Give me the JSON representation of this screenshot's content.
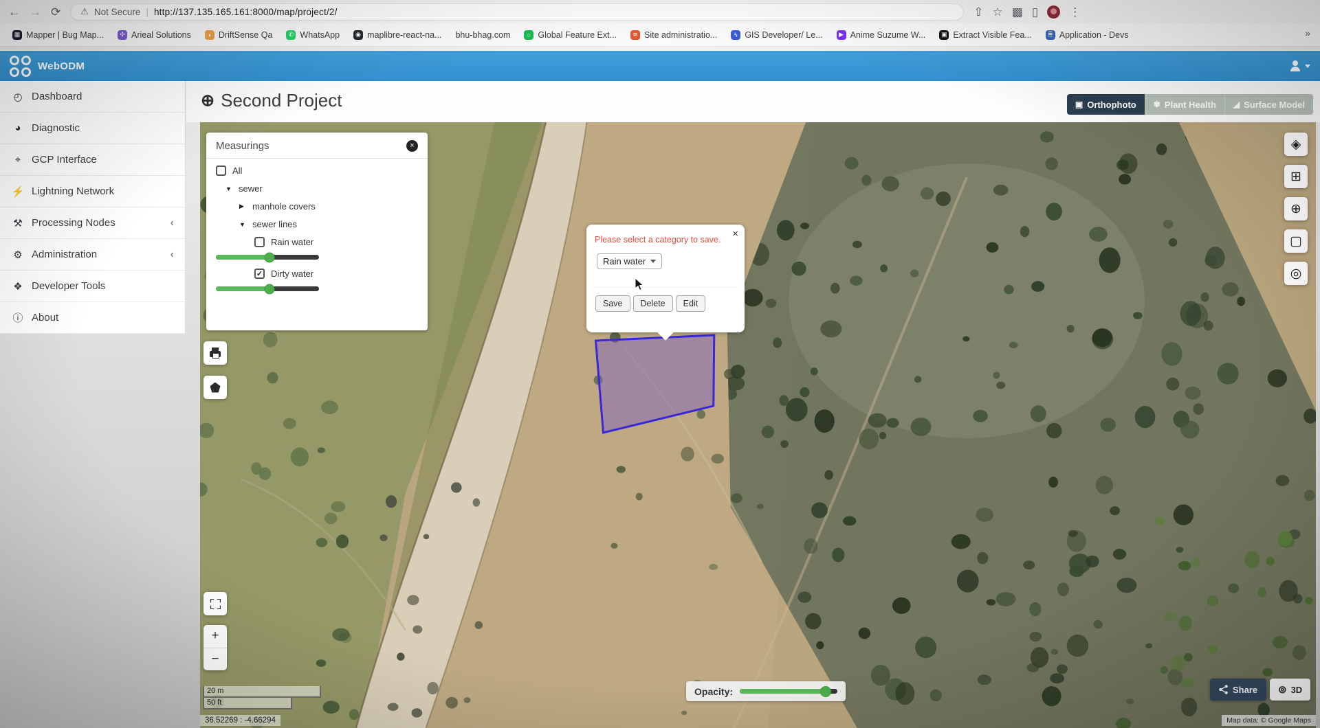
{
  "browser": {
    "security": "Not Secure",
    "url": "http://137.135.165.161:8000/map/project/2/",
    "overflow": "»",
    "bookmarks": [
      {
        "label": "Mapper | Bug Map...",
        "color": "#1b1b2f",
        "glyph": "▦"
      },
      {
        "label": "Arieal Solutions",
        "color": "#7b5cd6",
        "glyph": "✣"
      },
      {
        "label": "DriftSense Qa",
        "color": "#f0a24b",
        "glyph": "◖"
      },
      {
        "label": "WhatsApp",
        "color": "#25d366",
        "glyph": "✆"
      },
      {
        "label": "maplibre-react-na...",
        "color": "#24292e",
        "glyph": "◉"
      },
      {
        "label": "bhu-bhag.com",
        "color": "transparent",
        "glyph": ""
      },
      {
        "label": "Global Feature Ext...",
        "color": "#1db954",
        "glyph": "○"
      },
      {
        "label": "Site administratio...",
        "color": "#e4572e",
        "glyph": "≋"
      },
      {
        "label": "GIS Developer/ Le...",
        "color": "#3b5bdb",
        "glyph": "ϟ"
      },
      {
        "label": "Anime Suzume W...",
        "color": "#7b2ff7",
        "glyph": "▶"
      },
      {
        "label": "Extract Visible Fea...",
        "color": "#111111",
        "glyph": "▣"
      },
      {
        "label": "Application - Devs",
        "color": "#3567c4",
        "glyph": "≣"
      }
    ]
  },
  "navbar": {
    "brand": "WebODM"
  },
  "sidebar": {
    "items": [
      {
        "icon": "◴",
        "label": "Dashboard",
        "chevron": ""
      },
      {
        "icon": "◕",
        "label": "Diagnostic",
        "chevron": ""
      },
      {
        "icon": "⌖",
        "label": "GCP Interface",
        "chevron": ""
      },
      {
        "icon": "⚡",
        "label": "Lightning Network",
        "chevron": ""
      },
      {
        "icon": "⚒",
        "label": "Processing Nodes",
        "chevron": "‹"
      },
      {
        "icon": "⚙",
        "label": "Administration",
        "chevron": "‹"
      },
      {
        "icon": "❖",
        "label": "Developer Tools",
        "chevron": ""
      },
      {
        "icon": "ⓘ",
        "label": "About",
        "chevron": ""
      }
    ]
  },
  "header": {
    "title": "Second Project",
    "globe_icon": "⊕",
    "tabs": [
      {
        "icon": "▣",
        "label": "Orthophoto",
        "active": true
      },
      {
        "icon": "✾",
        "label": "Plant Health",
        "active": false
      },
      {
        "icon": "◢",
        "label": "Surface Model",
        "active": false
      }
    ]
  },
  "measurings": {
    "title": "Measurings",
    "close": "×",
    "rows": [
      {
        "label": "All",
        "checked": false
      },
      {
        "label": "sewer",
        "caret": "▼"
      },
      {
        "label": "manhole covers",
        "caret": "▶"
      },
      {
        "label": "sewer lines",
        "caret": "▼"
      },
      {
        "label": "Rain water",
        "checked": false,
        "slider_value": 52
      },
      {
        "label": "Dirty water",
        "checked": true,
        "check_glyph": "✓",
        "slider_value": 52
      }
    ]
  },
  "popup": {
    "message": "Please select a category to save.",
    "close": "×",
    "select_value": "Rain water",
    "buttons": [
      {
        "label": "Save"
      },
      {
        "label": "Delete"
      },
      {
        "label": "Edit"
      }
    ]
  },
  "map": {
    "controls": [
      {
        "glyph": "◈"
      },
      {
        "glyph": "⊞"
      },
      {
        "glyph": "⊕"
      },
      {
        "glyph": "▢"
      },
      {
        "glyph": "◎"
      }
    ],
    "zoom_in": "+",
    "zoom_out": "−",
    "opacity_label": "Opacity:",
    "opacity_value": 88,
    "share_label": "Share",
    "threed_label": "3D",
    "threed_glyph": "⊚",
    "scale_metric": "20 m",
    "scale_imperial": "50 ft",
    "coordinates": "36.52269 : -4.66294",
    "attribution": "Map data: © Google Maps"
  },
  "colors": {
    "navbar_blue": "#3a99d8",
    "tab_active": "#2b3e50",
    "tab_inactive": "#b7c1b8",
    "slider_green": "#5cb85c",
    "polygon_fill": "#7c5cc3",
    "polygon_stroke": "#3a28d8",
    "share_button": "#34495e",
    "error_text": "#e74c3c"
  }
}
